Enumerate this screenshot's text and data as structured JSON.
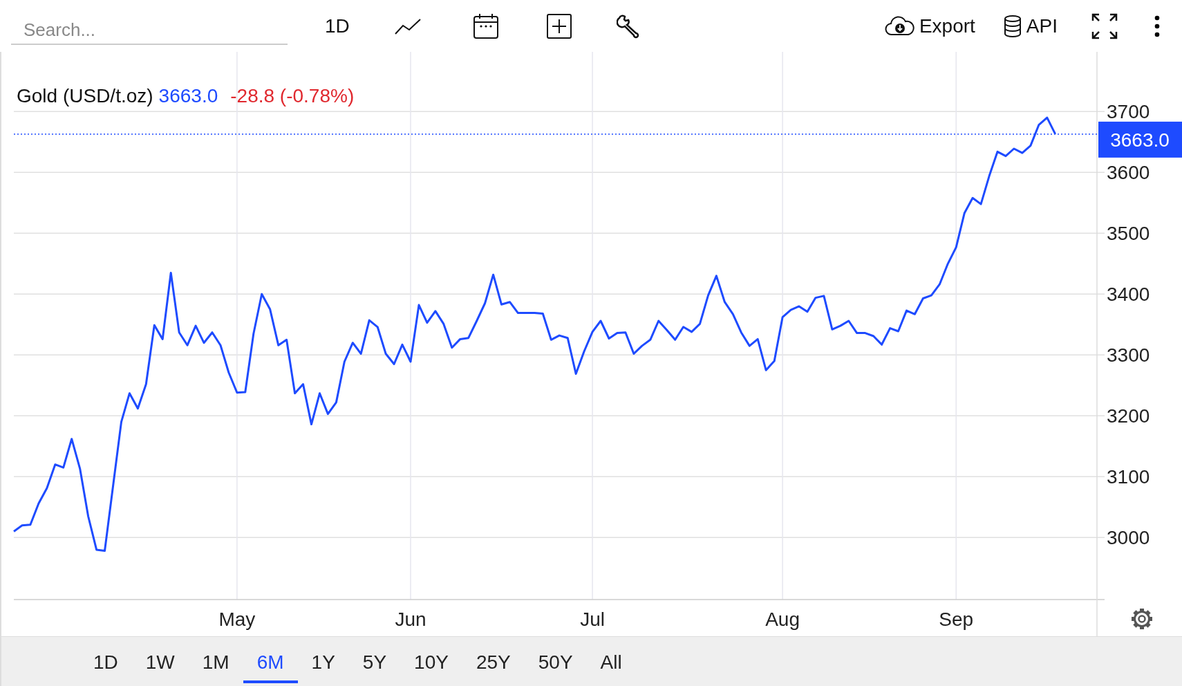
{
  "toolbar": {
    "search": {
      "placeholder": "Search..."
    },
    "interval": "1D",
    "export": "Export",
    "api": "API"
  },
  "legend": {
    "price": "3663.0",
    "change": "-28.8 (-0.78%)"
  },
  "chart_data": {
    "type": "line",
    "grid": true,
    "ylim": [
      2898,
      3797
    ],
    "categories": [
      null,
      null,
      null,
      null,
      null,
      null,
      null,
      null,
      null,
      null,
      null,
      null,
      null,
      null,
      null,
      null,
      null,
      null,
      null,
      null,
      null,
      null,
      null,
      null,
      null,
      null,
      null,
      "May",
      null,
      null,
      null,
      null,
      null,
      null,
      null,
      null,
      null,
      null,
      null,
      null,
      null,
      null,
      null,
      null,
      null,
      null,
      null,
      null,
      "Jun",
      null,
      null,
      null,
      null,
      null,
      null,
      null,
      null,
      null,
      null,
      null,
      null,
      null,
      null,
      null,
      null,
      null,
      null,
      null,
      null,
      null,
      "Jul",
      null,
      null,
      null,
      null,
      null,
      null,
      null,
      null,
      null,
      null,
      null,
      null,
      null,
      null,
      null,
      null,
      null,
      null,
      null,
      null,
      null,
      null,
      "Aug",
      null,
      null,
      null,
      null,
      null,
      null,
      null,
      null,
      null,
      null,
      null,
      null,
      null,
      null,
      null,
      null,
      null,
      null,
      null,
      null,
      "Sep",
      null,
      null,
      null,
      null,
      null,
      null,
      null,
      null,
      null,
      null,
      null,
      null
    ],
    "ref_lines": [
      {
        "axis": "y",
        "value": 3663.0,
        "label": "3663.0",
        "color": "#1e4bff"
      }
    ],
    "yticks": [
      3000,
      3100,
      3200,
      3300,
      3400,
      3500,
      3600,
      3700
    ],
    "series": [
      {
        "name": "Gold (USD/t.oz)",
        "color": "#1e4bff",
        "values": [
          3010,
          3020,
          3021,
          3056,
          3081,
          3120,
          3115,
          3162,
          3113,
          3035,
          2980,
          2978,
          3084,
          3190,
          3237,
          3212,
          3252,
          3349,
          3326,
          3435,
          3337,
          3316,
          3348,
          3320,
          3337,
          3316,
          3271,
          3238,
          3239,
          3335,
          3400,
          3375,
          3316,
          3325,
          3237,
          3252,
          3186,
          3237,
          3203,
          3222,
          3289,
          3320,
          3302,
          3357,
          3346,
          3302,
          3285,
          3317,
          3289,
          3382,
          3353,
          3372,
          3351,
          3312,
          3326,
          3328,
          3356,
          3385,
          3432,
          3383,
          3387,
          3369,
          3369,
          3369,
          3368,
          3325,
          3332,
          3328,
          3269,
          3306,
          3338,
          3356,
          3327,
          3336,
          3337,
          3302,
          3315,
          3325,
          3356,
          3341,
          3325,
          3346,
          3338,
          3351,
          3398,
          3430,
          3387,
          3367,
          3337,
          3315,
          3326,
          3275,
          3290,
          3362,
          3374,
          3380,
          3371,
          3394,
          3397,
          3342,
          3348,
          3356,
          3336,
          3336,
          3331,
          3317,
          3344,
          3339,
          3373,
          3367,
          3393,
          3398,
          3416,
          3450,
          3477,
          3533,
          3558,
          3548,
          3594,
          3634,
          3627,
          3639,
          3632,
          3644,
          3678,
          3690,
          3663
        ]
      }
    ]
  },
  "ranges": [
    {
      "label": "1D",
      "selected": false
    },
    {
      "label": "1W",
      "selected": false
    },
    {
      "label": "1M",
      "selected": false
    },
    {
      "label": "6M",
      "selected": true
    },
    {
      "label": "1Y",
      "selected": false
    },
    {
      "label": "5Y",
      "selected": false
    },
    {
      "label": "10Y",
      "selected": false
    },
    {
      "label": "25Y",
      "selected": false
    },
    {
      "label": "50Y",
      "selected": false
    },
    {
      "label": "All",
      "selected": false
    }
  ]
}
